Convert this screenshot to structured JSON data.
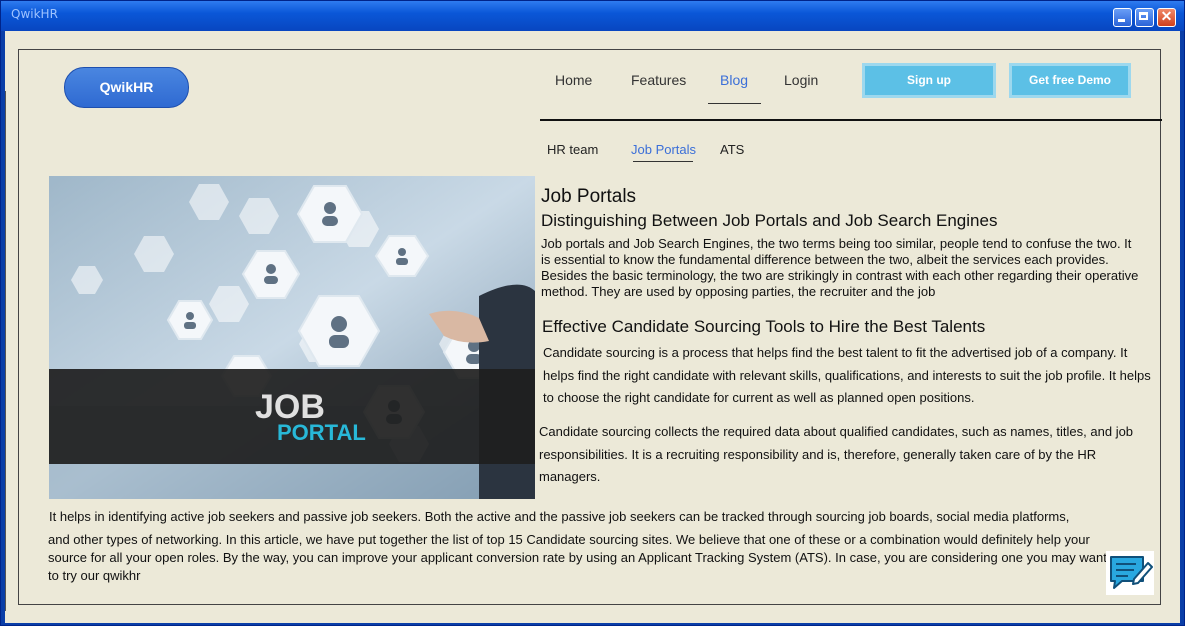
{
  "window": {
    "title": "QwikHR"
  },
  "header": {
    "logo": "QwikHR",
    "nav": [
      "Home",
      "Features",
      "Blog",
      "Login"
    ],
    "signup": "Sign up",
    "demo": "Get free Demo"
  },
  "subnav": [
    "HR team",
    "Job Portals",
    "ATS"
  ],
  "hero_image": {
    "line1": "JOB",
    "line2": "PORTAL"
  },
  "article": {
    "title": "Job Portals",
    "subtitle": "Distinguishing Between Job Portals and Job Search Engines",
    "intro": "Job portals and Job Search Engines, the two terms being too similar, people tend to confuse the two. It is essential to know the fundamental difference between the two, albeit the services each provides. Besides the basic terminology, the two are strikingly in contrast with each other regarding their operative method. They are used by opposing parties, the recruiter and the job",
    "section_title": "Effective Candidate Sourcing Tools to Hire the Best Talents",
    "p1": "Candidate sourcing is a process that helps find the best talent to fit the advertised job of a company. It helps find the right candidate with relevant skills, qualifications, and interests to suit the job profile. It helps to choose the right candidate for current as well as planned open positions.",
    "p2": "Candidate sourcing collects the required data about qualified candidates, such as names, titles, and job responsibilities. It is a recruiting responsibility and is, therefore, generally taken care of by the HR managers.",
    "p3a": "It helps in identifying active job seekers and passive job seekers. Both the active and the passive job seekers can be tracked through sourcing job boards, social media platforms,",
    "p3b": "and other types of networking. In this article, we have put together the list of top 15 Candidate sourcing sites. We believe that one of these or a combination would definitely help your source for all your open roles. By the way, you can improve your applicant conversion rate by using an Applicant Tracking System (ATS). In case, you are considering one you may want to try our qwikhr"
  },
  "colors": {
    "accent": "#3b6fd8",
    "cta": "#5cc0e6",
    "background": "#ece9d8"
  }
}
